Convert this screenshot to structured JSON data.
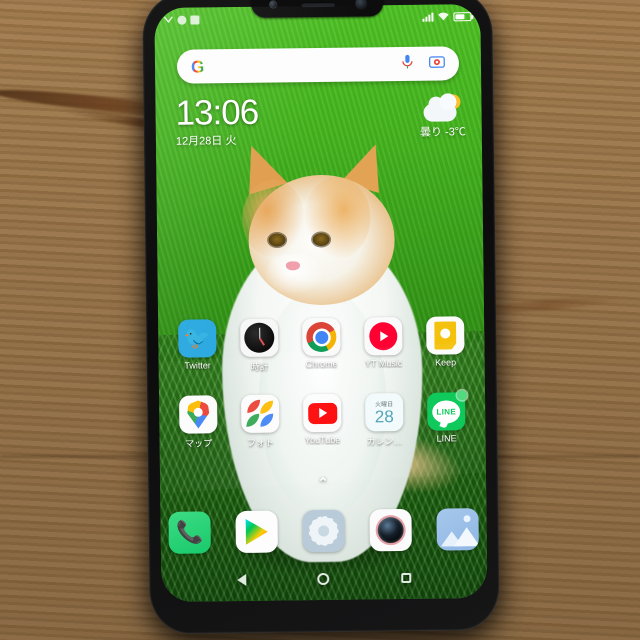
{
  "device": {
    "name": "android-smartphone",
    "case_color": "#c0392b",
    "bezel_color": "#0d0d0e"
  },
  "notch": {
    "front_camera": "front-camera-icon",
    "earpiece": "earpiece-speaker",
    "sensor": "proximity-sensor-icon"
  },
  "status_bar": {
    "left_icons": [
      "notification-icon-1",
      "notification-icon-2",
      "notification-icon-3"
    ],
    "right_icons": [
      "signal-bars-icon",
      "wifi-icon",
      "battery-icon"
    ]
  },
  "search": {
    "logo": "G",
    "placeholder": "",
    "mic_icon": "microphone-icon",
    "lens_icon": "google-lens-icon"
  },
  "widget": {
    "time": "13:06",
    "date": "12月28日 火",
    "weather_icon": "partly-cloudy-icon",
    "weather_text": "曇り  -3℃"
  },
  "home": {
    "rows": [
      [
        {
          "label": "Twitter",
          "icon": "twitter-icon"
        },
        {
          "label": "時計",
          "icon": "clock-icon"
        },
        {
          "label": "Chrome",
          "icon": "chrome-icon"
        },
        {
          "label": "YT Music",
          "icon": "youtube-music-icon"
        },
        {
          "label": "Keep",
          "icon": "google-keep-icon"
        }
      ],
      [
        {
          "label": "マップ",
          "icon": "google-maps-icon"
        },
        {
          "label": "フォト",
          "icon": "google-photos-icon"
        },
        {
          "label": "YouTube",
          "icon": "youtube-icon"
        },
        {
          "label": "カレン…",
          "icon": "calendar-icon",
          "day_of_week": "火曜日",
          "day_number": "28"
        },
        {
          "label": "LINE",
          "icon": "line-icon",
          "badge": true
        }
      ]
    ],
    "drawer_arrow": "⌃"
  },
  "dock": {
    "items": [
      {
        "label": "",
        "icon": "phone-icon"
      },
      {
        "label": "",
        "icon": "play-store-icon"
      },
      {
        "label": "",
        "icon": "settings-gear-icon"
      },
      {
        "label": "",
        "icon": "camera-icon"
      },
      {
        "label": "",
        "icon": "gallery-icon"
      }
    ]
  },
  "navigation_bar": {
    "back": "back-triangle-icon",
    "home": "home-circle-icon",
    "recents": "recents-square-icon"
  },
  "wallpaper": {
    "subject": "orange-and-white-cat-in-grass"
  }
}
